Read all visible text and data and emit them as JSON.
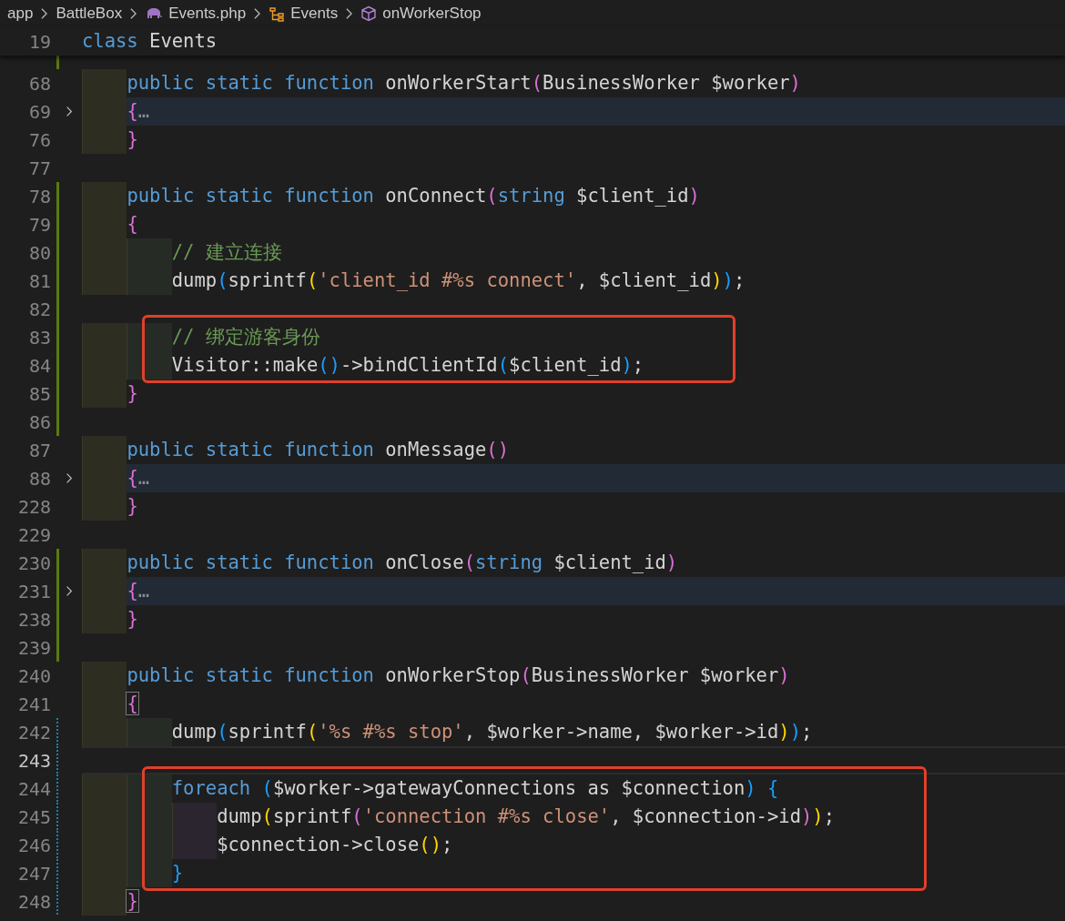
{
  "breadcrumb": [
    {
      "kind": "folder",
      "label": "app"
    },
    {
      "kind": "folder",
      "label": "BattleBox"
    },
    {
      "kind": "php-file",
      "label": "Events.php"
    },
    {
      "kind": "class",
      "label": "Events"
    },
    {
      "kind": "method",
      "label": "onWorkerStop"
    }
  ],
  "sticky_line": {
    "number": "19",
    "tokens": [
      {
        "kind": "keyword",
        "text": "class"
      },
      {
        "kind": "plain",
        "text": " Events"
      }
    ]
  },
  "lines": [
    {
      "kind": "line",
      "partial": true,
      "added": true
    },
    {
      "kind": "line",
      "number": "68",
      "tokens": [
        {
          "kind": "keyword",
          "text": "public static function"
        },
        {
          "kind": "plain",
          "text": " onWorkerStart"
        },
        {
          "kind": "bracket-pink",
          "text": "("
        },
        {
          "kind": "plain",
          "text": "BusinessWorker $worker"
        },
        {
          "kind": "bracket-pink",
          "text": ")"
        }
      ]
    },
    {
      "kind": "line",
      "number": "69",
      "folded": true,
      "tokens": [
        {
          "kind": "bracket-pink",
          "text": "{"
        },
        {
          "kind": "ellipsis",
          "text": "…"
        }
      ]
    },
    {
      "kind": "line",
      "number": "76",
      "tokens": [
        {
          "kind": "bracket-pink",
          "text": "}"
        }
      ]
    },
    {
      "kind": "line",
      "number": "77"
    },
    {
      "kind": "line",
      "number": "78",
      "added": true,
      "tokens": [
        {
          "kind": "keyword",
          "text": "public static function"
        },
        {
          "kind": "plain",
          "text": " onConnect"
        },
        {
          "kind": "bracket-pink",
          "text": "("
        },
        {
          "kind": "keyword",
          "text": "string"
        },
        {
          "kind": "plain",
          "text": " $client_id"
        },
        {
          "kind": "bracket-pink",
          "text": ")"
        }
      ]
    },
    {
      "kind": "line",
      "number": "79",
      "added": true,
      "tokens": [
        {
          "kind": "bracket-pink",
          "text": "{"
        }
      ],
      "children": [
        {
          "kind": "line",
          "number": "80",
          "added": true,
          "tokens": [
            {
              "kind": "comment",
              "text": "// 建立连接"
            }
          ]
        },
        {
          "kind": "line",
          "number": "81",
          "added": true,
          "tokens": [
            {
              "kind": "plain",
              "text": "dump"
            },
            {
              "kind": "bracket-blue",
              "text": "("
            },
            {
              "kind": "plain",
              "text": "sprintf"
            },
            {
              "kind": "bracket-yellow",
              "text": "("
            },
            {
              "kind": "string",
              "text": "'client_id #%s connect'"
            },
            {
              "kind": "plain",
              "text": ", $client_id"
            },
            {
              "kind": "bracket-yellow",
              "text": ")"
            },
            {
              "kind": "bracket-blue",
              "text": ")"
            },
            {
              "kind": "plain",
              "text": ";"
            }
          ]
        },
        {
          "kind": "line",
          "number": "82",
          "added": true
        },
        {
          "kind": "annotation",
          "lines": [
            {
              "kind": "line",
              "number": "83",
              "added": true,
              "tokens": [
                {
                  "kind": "comment",
                  "text": "// 绑定游客身份"
                }
              ]
            },
            {
              "kind": "line",
              "number": "84",
              "added": true,
              "tokens": [
                {
                  "kind": "plain",
                  "text": "Visitor::make"
                },
                {
                  "kind": "bracket-blue",
                  "text": "()"
                },
                {
                  "kind": "plain",
                  "text": "->bindClientId"
                },
                {
                  "kind": "bracket-blue",
                  "text": "("
                },
                {
                  "kind": "plain",
                  "text": "$client_id"
                },
                {
                  "kind": "bracket-blue",
                  "text": ")"
                },
                {
                  "kind": "plain",
                  "text": ";"
                }
              ]
            }
          ]
        }
      ]
    },
    {
      "kind": "line",
      "number": "85",
      "added": true,
      "tokens": [
        {
          "kind": "bracket-pink",
          "text": "}"
        }
      ]
    },
    {
      "kind": "line",
      "number": "86",
      "added": true
    },
    {
      "kind": "line",
      "number": "87",
      "tokens": [
        {
          "kind": "keyword",
          "text": "public static function"
        },
        {
          "kind": "plain",
          "text": " onMessage"
        },
        {
          "kind": "bracket-pink",
          "text": "()"
        }
      ]
    },
    {
      "kind": "line",
      "number": "88",
      "folded": true,
      "tokens": [
        {
          "kind": "bracket-pink",
          "text": "{"
        },
        {
          "kind": "ellipsis",
          "text": "…"
        }
      ]
    },
    {
      "kind": "line",
      "number": "228",
      "tokens": [
        {
          "kind": "bracket-pink",
          "text": "}"
        }
      ]
    },
    {
      "kind": "line",
      "number": "229"
    },
    {
      "kind": "line",
      "number": "230",
      "added": true,
      "tokens": [
        {
          "kind": "keyword",
          "text": "public static function"
        },
        {
          "kind": "plain",
          "text": " onClose"
        },
        {
          "kind": "bracket-pink",
          "text": "("
        },
        {
          "kind": "keyword",
          "text": "string"
        },
        {
          "kind": "plain",
          "text": " $client_id"
        },
        {
          "kind": "bracket-pink",
          "text": ")"
        }
      ]
    },
    {
      "kind": "line",
      "number": "231",
      "folded": true,
      "added": true,
      "tokens": [
        {
          "kind": "bracket-pink",
          "text": "{"
        },
        {
          "kind": "ellipsis",
          "text": "…"
        }
      ]
    },
    {
      "kind": "line",
      "number": "238",
      "added": true,
      "tokens": [
        {
          "kind": "bracket-pink",
          "text": "}"
        }
      ]
    },
    {
      "kind": "line",
      "number": "239",
      "added": true
    },
    {
      "kind": "line",
      "number": "240",
      "tokens": [
        {
          "kind": "keyword",
          "text": "public static function"
        },
        {
          "kind": "plain",
          "text": " onWorkerStop"
        },
        {
          "kind": "bracket-pink",
          "text": "("
        },
        {
          "kind": "plain",
          "text": "BusinessWorker $worker"
        },
        {
          "kind": "bracket-pink",
          "text": ")"
        }
      ]
    },
    {
      "kind": "line",
      "number": "241",
      "tokens": [
        {
          "kind": "bracket-pink",
          "text": "{",
          "matched": true
        }
      ],
      "children": [
        {
          "kind": "line",
          "number": "242",
          "modified": true,
          "tokens": [
            {
              "kind": "plain",
              "text": "dump"
            },
            {
              "kind": "bracket-blue",
              "text": "("
            },
            {
              "kind": "plain",
              "text": "sprintf"
            },
            {
              "kind": "bracket-yellow",
              "text": "("
            },
            {
              "kind": "string",
              "text": "'%s #%s stop'"
            },
            {
              "kind": "plain",
              "text": ", $worker->name, $worker->id"
            },
            {
              "kind": "bracket-yellow",
              "text": ")"
            },
            {
              "kind": "bracket-blue",
              "text": ")"
            },
            {
              "kind": "plain",
              "text": ";"
            }
          ]
        },
        {
          "kind": "line",
          "number": "243",
          "current": true,
          "modified": true
        },
        {
          "kind": "annotation",
          "lines": [
            {
              "kind": "line",
              "number": "244",
              "modified": true,
              "tokens": [
                {
                  "kind": "keyword",
                  "text": "foreach"
                },
                {
                  "kind": "bracket-blue",
                  "text": " ("
                },
                {
                  "kind": "plain",
                  "text": "$worker->gatewayConnections as $connection"
                },
                {
                  "kind": "bracket-blue",
                  "text": ") {"
                }
              ],
              "children": [
                {
                  "kind": "line",
                  "number": "245",
                  "modified": true,
                  "tokens": [
                    {
                      "kind": "plain",
                      "text": "dump"
                    },
                    {
                      "kind": "bracket-yellow",
                      "text": "("
                    },
                    {
                      "kind": "plain",
                      "text": "sprintf"
                    },
                    {
                      "kind": "bracket-pink",
                      "text": "("
                    },
                    {
                      "kind": "string",
                      "text": "'connection #%s close'"
                    },
                    {
                      "kind": "plain",
                      "text": ", $connection->id"
                    },
                    {
                      "kind": "bracket-pink",
                      "text": ")"
                    },
                    {
                      "kind": "bracket-yellow",
                      "text": ")"
                    },
                    {
                      "kind": "plain",
                      "text": ";"
                    }
                  ]
                },
                {
                  "kind": "line",
                  "number": "246",
                  "modified": true,
                  "tokens": [
                    {
                      "kind": "plain",
                      "text": "$connection->close"
                    },
                    {
                      "kind": "bracket-yellow",
                      "text": "()"
                    },
                    {
                      "kind": "plain",
                      "text": ";"
                    }
                  ]
                }
              ]
            },
            {
              "kind": "line",
              "number": "247",
              "modified": true,
              "tokens": [
                {
                  "kind": "bracket-blue",
                  "text": "}"
                }
              ]
            }
          ]
        }
      ]
    },
    {
      "kind": "line",
      "number": "248",
      "modified": true,
      "tokens": [
        {
          "kind": "bracket-pink",
          "text": "}",
          "matched": true
        }
      ]
    }
  ]
}
